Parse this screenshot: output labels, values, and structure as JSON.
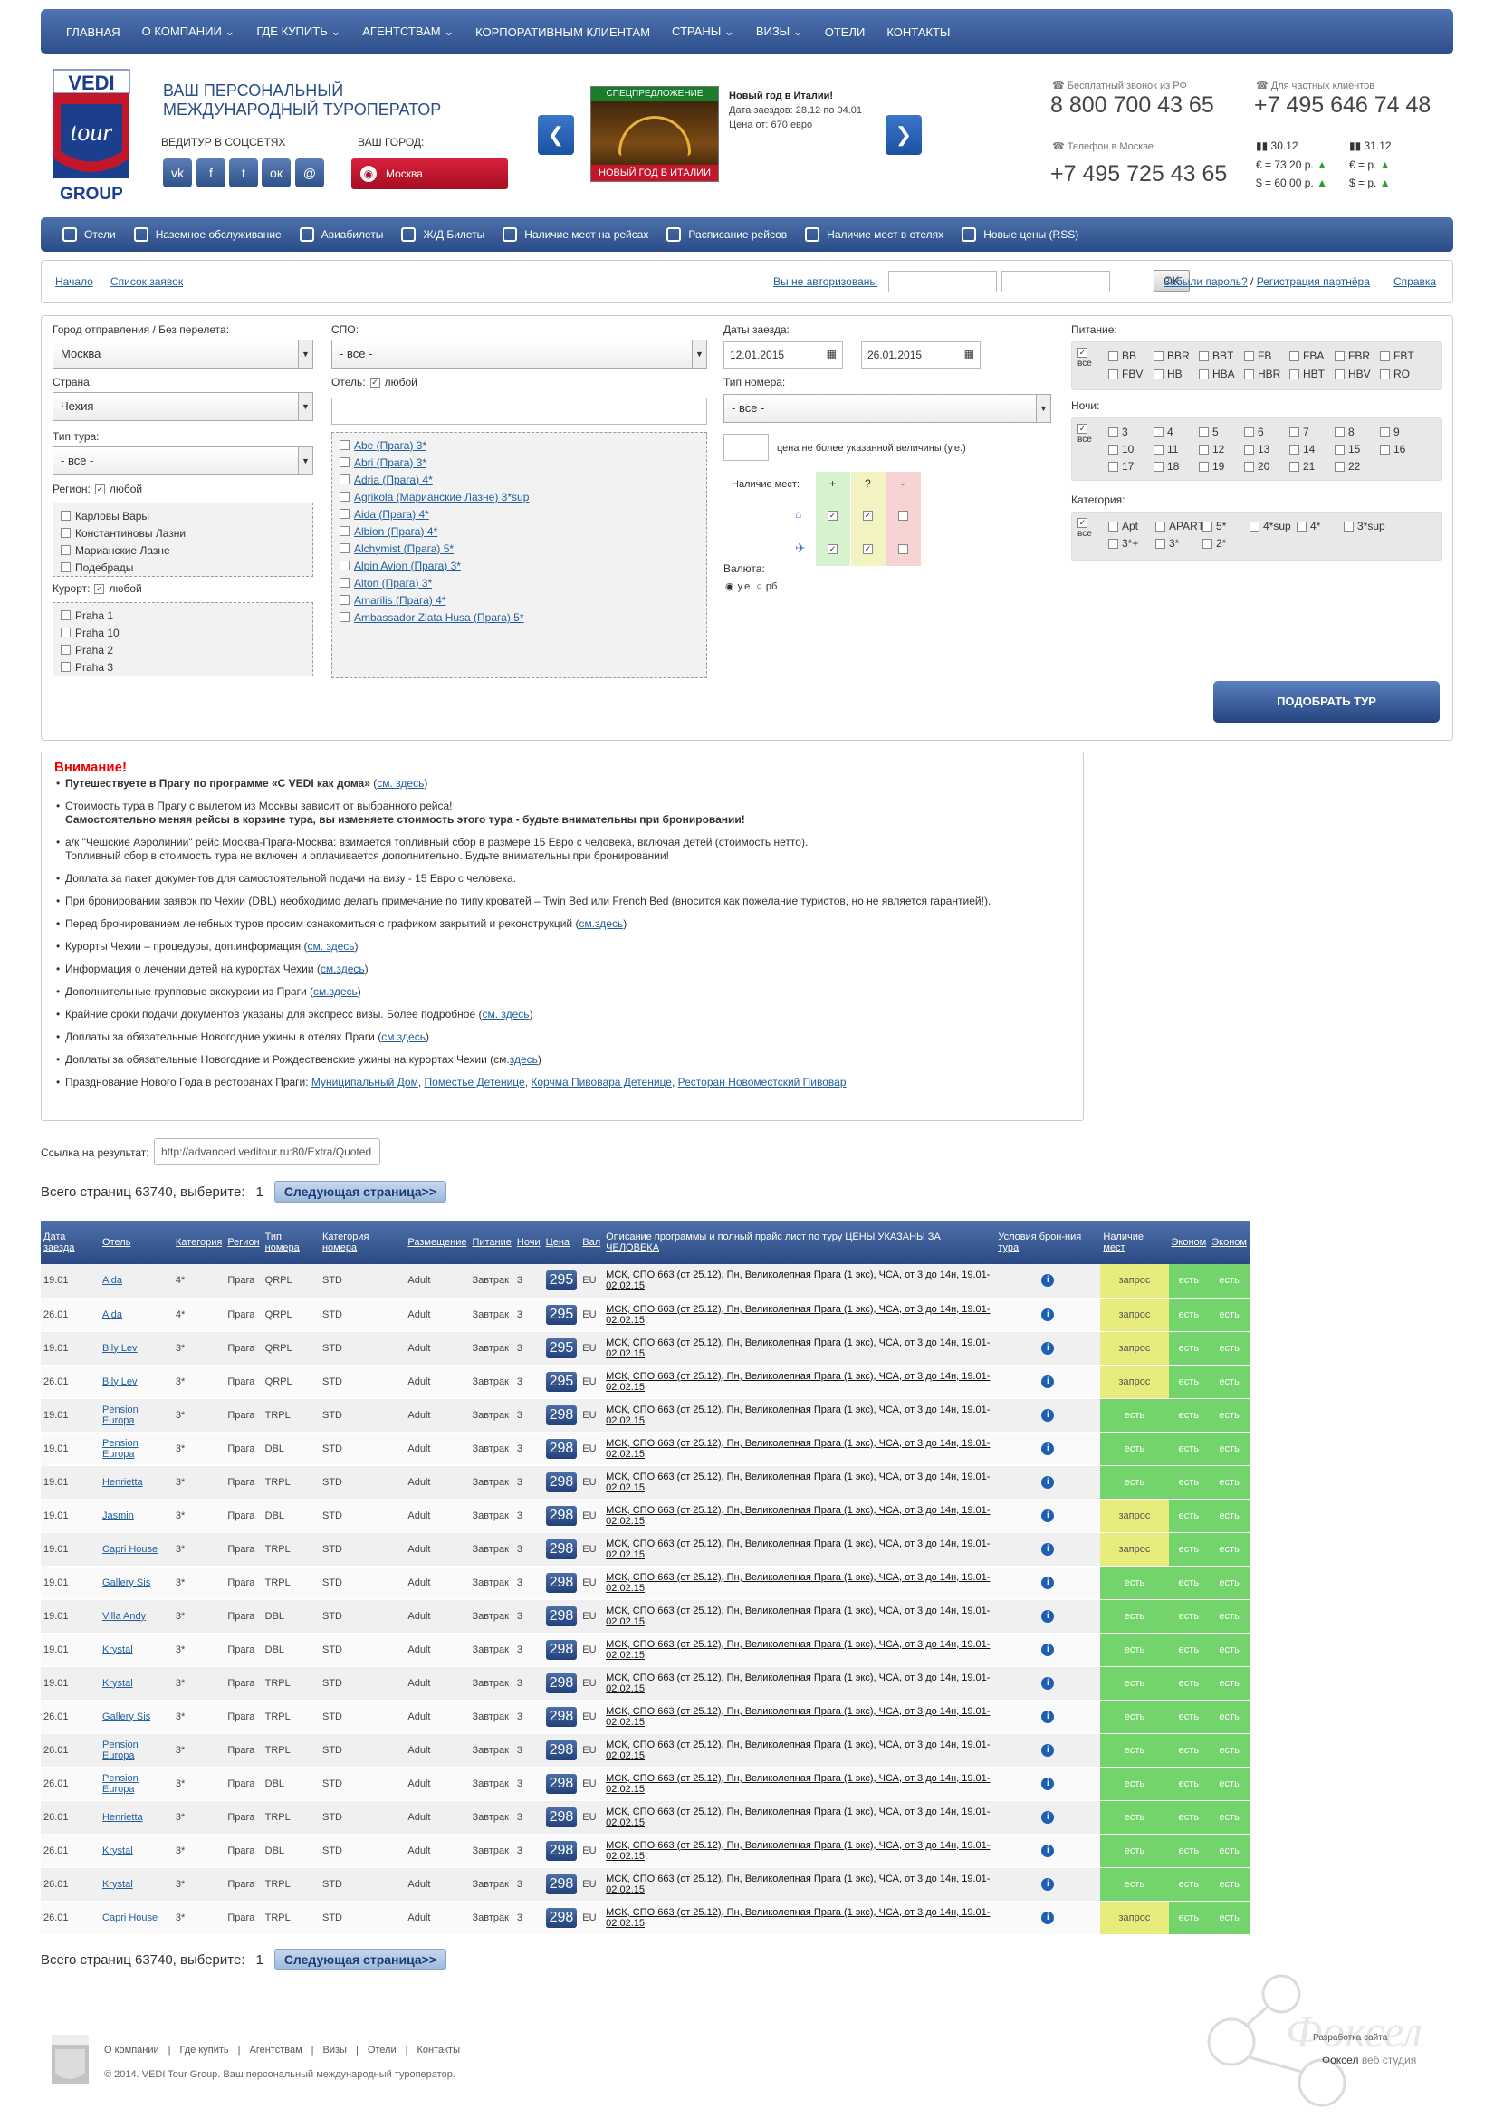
{
  "topnav": [
    "ГЛАВНАЯ",
    "О КОМПАНИИ ⌄",
    "ГДЕ КУПИТЬ ⌄",
    "АГЕНТСТВАМ ⌄",
    "КОРПОРАТИВНЫМ КЛИЕНТАМ",
    "СТРАНЫ ⌄",
    "ВИЗЫ ⌄",
    "ОТЕЛИ",
    "КОНТАКТЫ"
  ],
  "brand": {
    "name": "VEDI",
    "name2": "tour",
    "group": "GROUP",
    "tagline": "ВАШ ПЕРСОНАЛЬНЫЙ МЕЖДУНАРОДНЫЙ ТУРОПЕРАТОР",
    "social_label": "ВЕДИТУР В СОЦСЕТЯХ",
    "city_label": "ВАШ ГОРОД:",
    "city": "Москва"
  },
  "promo": {
    "badge": "СПЕЦПРЕДЛОЖЕНИЕ",
    "banner": "НОВЫЙ ГОД В ИТАЛИИ",
    "title": "Новый год в Италии!",
    "dates": "Дата заездов: 28.12 по 04.01",
    "price": "Цена от: 670 евро"
  },
  "contacts": {
    "free_label": "Бесплатный звонок из РФ",
    "free_phone": "8 800 700 43 65",
    "private_label": "Для частных клиентов",
    "private_phone": "+7 495 646 74 48",
    "moscow_label": "Телефон в Москве",
    "moscow_phone": "+7 495 725 43 65",
    "date1": "30.12",
    "eur1": "€ = 73.20 р.",
    "usd1": "$ = 60.00 р.",
    "date2": "31.12",
    "eur2": "€ = р.",
    "usd2": "$ = р."
  },
  "subnav": [
    "Отели",
    "Наземное обслуживание",
    "Авиабилеты",
    "Ж/Д Билеты",
    "Наличие мест на рейсах",
    "Расписание рейсов",
    "Наличие мест в отелях",
    "Новые цены (RSS)"
  ],
  "crumbs": {
    "home": "Начало",
    "list": "Список заявок",
    "auth": "Вы не авторизованы",
    "ok": "OK",
    "forgot": "Забыли пароль?",
    "sep": "/",
    "reg": "Регистрация партнёра",
    "help": "Справка"
  },
  "form": {
    "dep_label": "Город отправления / Без перелета:",
    "dep": "Москва",
    "country_label": "Страна:",
    "country": "Чехия",
    "tourtype_label": "Тип тура:",
    "tourtype": "- все -",
    "region_label": "Регион:",
    "any": "любой",
    "regions": [
      "Карловы Вары",
      "Константиновы Лазни",
      "Марианские Лазне",
      "Подебрады"
    ],
    "resort_label": "Курорт:",
    "resorts": [
      "Praha 1",
      "Praha 10",
      "Praha 2",
      "Praha 3"
    ],
    "spo_label": "СПО:",
    "spo": "- все -",
    "hotel_label": "Отель:",
    "hotels": [
      "Abe (Прага) 3*",
      "Abri (Прага) 3*",
      "Adria (Прага) 4*",
      "Agrikola (Марианские Лазне) 3*sup",
      "Aida (Прага) 4*",
      "Albion (Прага) 4*",
      "Alchymist (Прага) 5*",
      "Alpin Avion (Прага) 3*",
      "Alton (Прага) 3*",
      "Amarilis (Прага) 4*",
      "Ambassador Zlata Husa (Прага) 5*"
    ],
    "dates_label": "Даты заезда:",
    "date_from": "12.01.2015",
    "date_to": "26.01.2015",
    "room_label": "Тип номера:",
    "room": "- все -",
    "price_note": "цена не более указанной величины (у.е.)",
    "avail_label": "Наличие мест:",
    "plus": "+",
    "q": "?",
    "minus": "-",
    "currency_label": "Валюта:",
    "cur1": "у.е.",
    "cur2": "рб",
    "meals_label": "Питание:",
    "all": "все",
    "meals": [
      "BB",
      "BBR",
      "BBT",
      "FB",
      "FBA",
      "FBR",
      "FBT",
      "FBV",
      "HB",
      "HBA",
      "HBR",
      "HBT",
      "HBV",
      "RO"
    ],
    "nights_label": "Ночи:",
    "nights": [
      "3",
      "4",
      "5",
      "6",
      "7",
      "8",
      "9",
      "10",
      "11",
      "12",
      "13",
      "14",
      "15",
      "16",
      "17",
      "18",
      "19",
      "20",
      "21",
      "22"
    ],
    "cat_label": "Категория:",
    "cats": [
      "Apt",
      "APART",
      "5*",
      "4*sup",
      "4*",
      "3*sup",
      "3*+",
      "3*",
      "2*"
    ],
    "submit": "ПОДОБРАТЬ ТУР"
  },
  "notice": {
    "title": "Внимание!",
    "items": [
      {
        "b": "Путешествуете в Прагу по программе «С VEDI как дома»",
        "t": " (",
        "l": "см. здесь",
        "e": ")"
      },
      {
        "t": "Стоимость тура в Прагу с вылетом из Москвы зависит от выбранного рейса!",
        "b2": "Самостоятельно меняя рейсы в корзине тура, вы изменяете стоимость этого тура - будьте внимательны при бронировании!"
      },
      {
        "t": "а/к \"Чешские Аэролинии\" рейс Москва-Прага-Москва: взимается топливный сбор в размере 15 Евро с человека, включая детей (стоимость нетто).",
        "t2": "Топливный сбор в стоимость тура не включен и оплачивается дополнительно. Будьте внимательны при бронировании!"
      },
      {
        "t": "Доплата за пакет документов для самостоятельной подачи на визу - 15 Евро с человека."
      },
      {
        "t": "При бронировании заявок по Чехии (DBL) необходимо делать примечание по типу кроватей – Twin Bed или French Bed (вносится как пожелание туристов, но не является гарантией!)."
      },
      {
        "t": "Перед бронированием лечебных туров просим ознакомиться с графиком закрытий и реконструкций (",
        "l": "см.здесь",
        "e": ")"
      },
      {
        "t": "Курорты Чехии – процедуры, доп.информация (",
        "l": "см. здесь",
        "e": ")"
      },
      {
        "t": "Информация о лечении детей на курортах Чехии (",
        "l": "см.здесь",
        "e": ")"
      },
      {
        "t": "Дополнительные групповые экскурсии из Праги (",
        "l": "см.здесь",
        "e": ")"
      },
      {
        "t": "Крайние сроки подачи документов указаны для экспресс визы. Более подробное (",
        "l": "см. здесь",
        "e": ")"
      },
      {
        "t": "Доплаты за обязательные Новогодние ужины в отелях Праги (",
        "l": "см.здесь",
        "e": ")"
      },
      {
        "t": "Доплаты за обязательные Новогодние и Рождественские ужины на курортах Чехии (см.",
        "l": "здесь",
        "e": ")"
      },
      {
        "t": "Празднование Нового Года в ресторанах Праги: ",
        "l": "Муниципальный Дом",
        "e": ", ",
        "l2": "Поместье Детенице",
        "e2": ", ",
        "l3": "Корчма Пивовара Детенице",
        "e3": ", ",
        "l4": "Ресторан Новоместский Пивовар"
      }
    ]
  },
  "results": {
    "link_label": "Ссылка на результат:",
    "link": "http://advanced.veditour.ru:80/Extra/Quoted",
    "pager_text": "Всего страниц 63740, выберите:",
    "page": "1",
    "next": "Следующая страница>>",
    "headers": [
      "Дата заезда",
      "Отель",
      "Категория",
      "Регион",
      "Тип номера",
      "Категория номера",
      "Размещение",
      "Питание",
      "Ночи",
      "Цена",
      "Вал",
      "Описание программы и полный прайс лист по туру ЦЕНЫ УКАЗАНЫ ЗА ЧЕЛОВЕКА",
      "Условия брон-ния тура",
      "Наличие мест",
      "Эконом",
      "Эконом"
    ],
    "desc": "МСК, СПО 663 (от 25.12), Пн, Великолепная Прага (1 экс), ЧСА, от 3 до 14н, 19.01-02.02.15",
    "rows": [
      [
        "19.01",
        "Aida",
        "4*",
        "Прага",
        "QRPL",
        "STD",
        "Adult",
        "Завтрак",
        "3",
        "295",
        "EU",
        "запрос",
        "есть",
        "есть"
      ],
      [
        "26.01",
        "Aida",
        "4*",
        "Прага",
        "QRPL",
        "STD",
        "Adult",
        "Завтрак",
        "3",
        "295",
        "EU",
        "запрос",
        "есть",
        "есть"
      ],
      [
        "19.01",
        "Bily Lev",
        "3*",
        "Прага",
        "QRPL",
        "STD",
        "Adult",
        "Завтрак",
        "3",
        "295",
        "EU",
        "запрос",
        "есть",
        "есть"
      ],
      [
        "26.01",
        "Bily Lev",
        "3*",
        "Прага",
        "QRPL",
        "STD",
        "Adult",
        "Завтрак",
        "3",
        "295",
        "EU",
        "запрос",
        "есть",
        "есть"
      ],
      [
        "19.01",
        "Pension Europa",
        "3*",
        "Прага",
        "TRPL",
        "STD",
        "Adult",
        "Завтрак",
        "3",
        "298",
        "EU",
        "есть",
        "есть",
        "есть"
      ],
      [
        "19.01",
        "Pension Europa",
        "3*",
        "Прага",
        "DBL",
        "STD",
        "Adult",
        "Завтрак",
        "3",
        "298",
        "EU",
        "есть",
        "есть",
        "есть"
      ],
      [
        "19.01",
        "Henrietta",
        "3*",
        "Прага",
        "TRPL",
        "STD",
        "Adult",
        "Завтрак",
        "3",
        "298",
        "EU",
        "есть",
        "есть",
        "есть"
      ],
      [
        "19.01",
        "Jasmin",
        "3*",
        "Прага",
        "DBL",
        "STD",
        "Adult",
        "Завтрак",
        "3",
        "298",
        "EU",
        "запрос",
        "есть",
        "есть"
      ],
      [
        "19.01",
        "Capri House",
        "3*",
        "Прага",
        "TRPL",
        "STD",
        "Adult",
        "Завтрак",
        "3",
        "298",
        "EU",
        "запрос",
        "есть",
        "есть"
      ],
      [
        "19.01",
        "Gallery Sis",
        "3*",
        "Прага",
        "TRPL",
        "STD",
        "Adult",
        "Завтрак",
        "3",
        "298",
        "EU",
        "есть",
        "есть",
        "есть"
      ],
      [
        "19.01",
        "Villa Andy",
        "3*",
        "Прага",
        "DBL",
        "STD",
        "Adult",
        "Завтрак",
        "3",
        "298",
        "EU",
        "есть",
        "есть",
        "есть"
      ],
      [
        "19.01",
        "Krystal",
        "3*",
        "Прага",
        "DBL",
        "STD",
        "Adult",
        "Завтрак",
        "3",
        "298",
        "EU",
        "есть",
        "есть",
        "есть"
      ],
      [
        "19.01",
        "Krystal",
        "3*",
        "Прага",
        "TRPL",
        "STD",
        "Adult",
        "Завтрак",
        "3",
        "298",
        "EU",
        "есть",
        "есть",
        "есть"
      ],
      [
        "26.01",
        "Gallery Sis",
        "3*",
        "Прага",
        "TRPL",
        "STD",
        "Adult",
        "Завтрак",
        "3",
        "298",
        "EU",
        "есть",
        "есть",
        "есть"
      ],
      [
        "26.01",
        "Pension Europa",
        "3*",
        "Прага",
        "TRPL",
        "STD",
        "Adult",
        "Завтрак",
        "3",
        "298",
        "EU",
        "есть",
        "есть",
        "есть"
      ],
      [
        "26.01",
        "Pension Europa",
        "3*",
        "Прага",
        "DBL",
        "STD",
        "Adult",
        "Завтрак",
        "3",
        "298",
        "EU",
        "есть",
        "есть",
        "есть"
      ],
      [
        "26.01",
        "Henrietta",
        "3*",
        "Прага",
        "TRPL",
        "STD",
        "Adult",
        "Завтрак",
        "3",
        "298",
        "EU",
        "есть",
        "есть",
        "есть"
      ],
      [
        "26.01",
        "Krystal",
        "3*",
        "Прага",
        "DBL",
        "STD",
        "Adult",
        "Завтрак",
        "3",
        "298",
        "EU",
        "есть",
        "есть",
        "есть"
      ],
      [
        "26.01",
        "Krystal",
        "3*",
        "Прага",
        "TRPL",
        "STD",
        "Adult",
        "Завтрак",
        "3",
        "298",
        "EU",
        "есть",
        "есть",
        "есть"
      ],
      [
        "26.01",
        "Capri House",
        "3*",
        "Прага",
        "TRPL",
        "STD",
        "Adult",
        "Завтрак",
        "3",
        "298",
        "EU",
        "запрос",
        "есть",
        "есть"
      ]
    ]
  },
  "footer": {
    "links": [
      "О компании",
      "Где купить",
      "Агентствам",
      "Визы",
      "Отели",
      "Контакты"
    ],
    "copy": "© 2014. VEDI Tour Group. Ваш персональный международный туроператор.",
    "dev": "Разработка сайта",
    "dev2": "Фоксел",
    "studio": "веб студия",
    "foxel": "Фоксел"
  }
}
